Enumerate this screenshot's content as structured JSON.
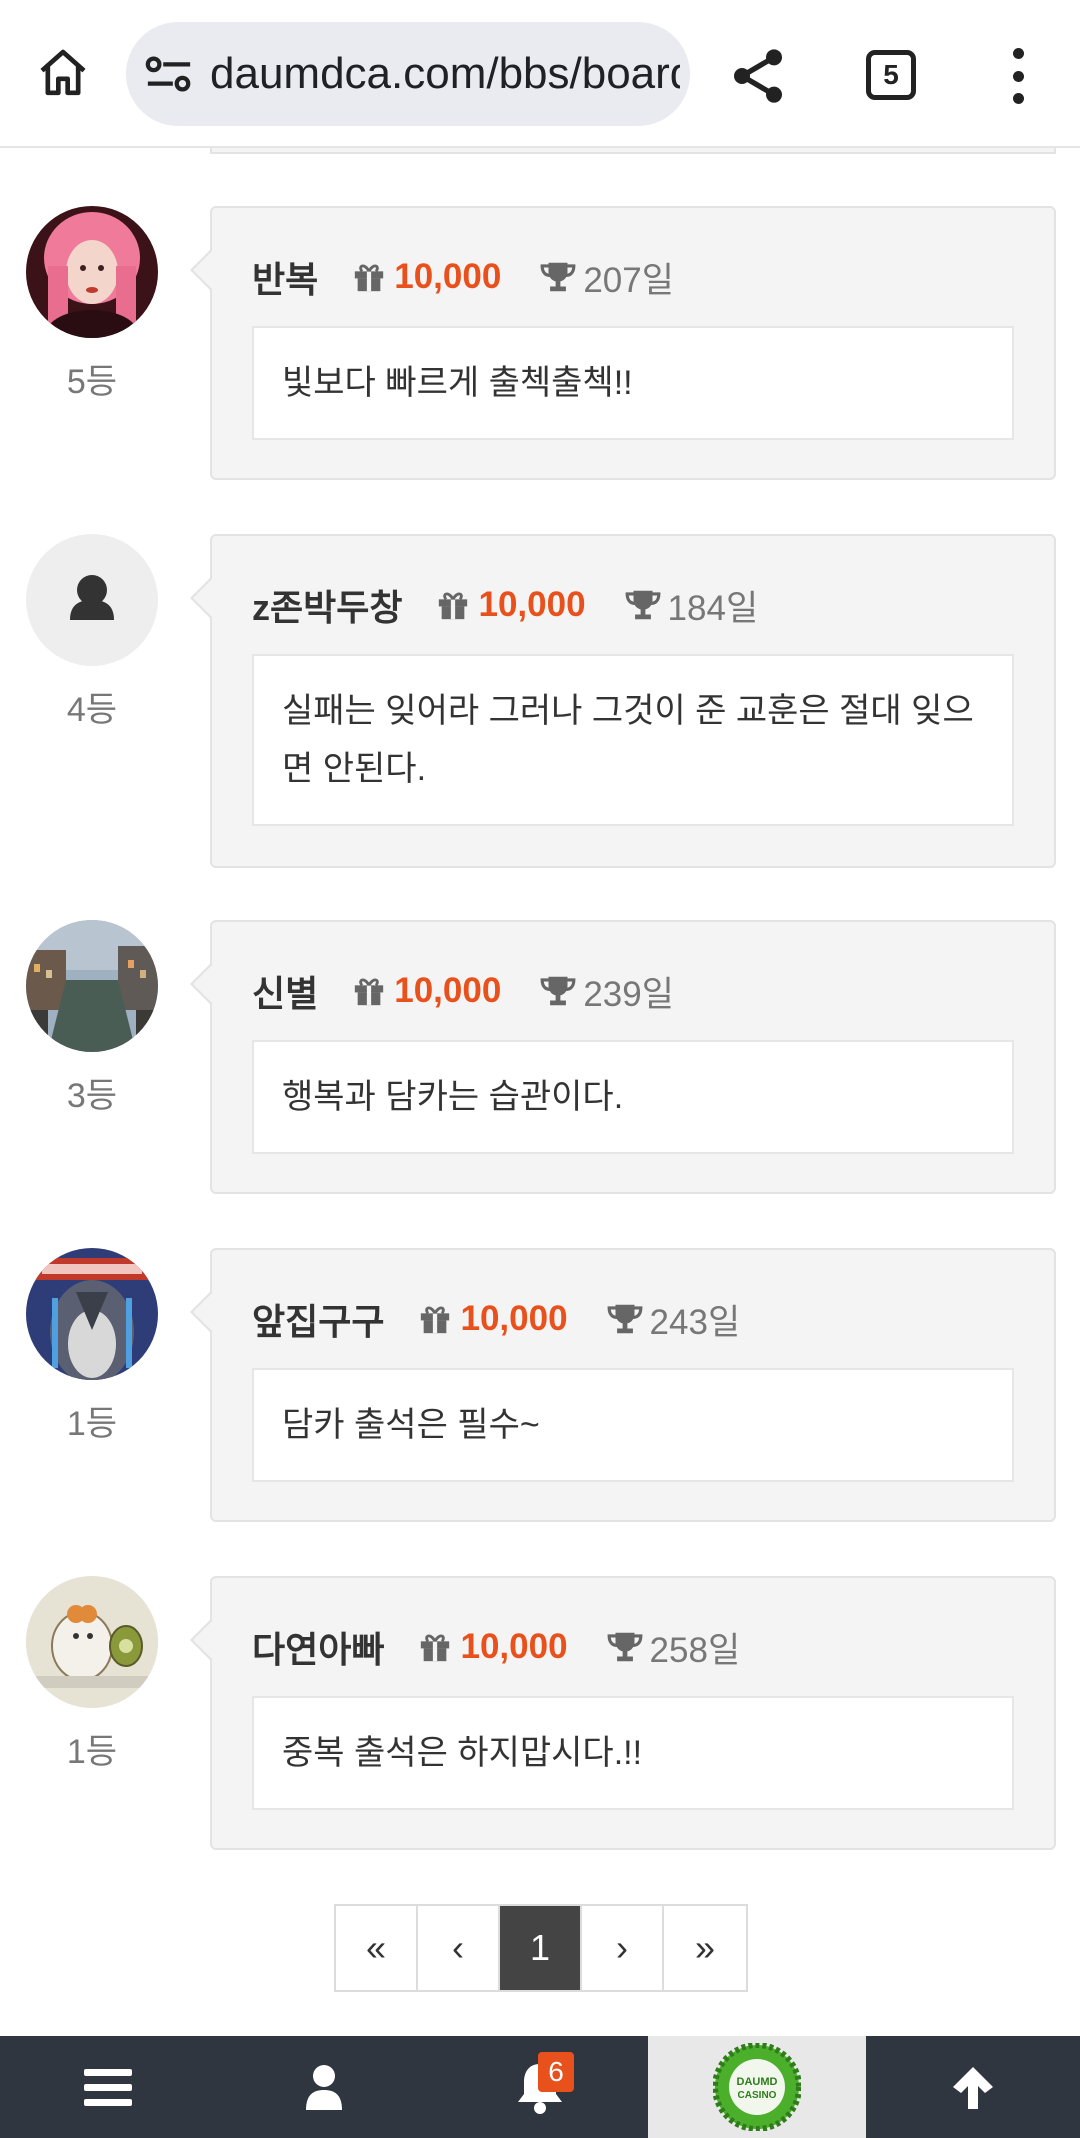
{
  "browser": {
    "url": "daumdca.com/bbs/board",
    "tab_count": "5"
  },
  "comments": [
    {
      "name": "반복",
      "points": "10,000",
      "days": "207일",
      "rank": "5등",
      "message": "빛보다 빠르게 출첵출첵!!",
      "avatar": "pink-hair-portrait"
    },
    {
      "name": "z존박두창",
      "points": "10,000",
      "days": "184일",
      "rank": "4등",
      "message": "실패는 잊어라 그러나 그것이 준 교훈은 절대 잊으면 안된다.",
      "avatar": "default-user"
    },
    {
      "name": "신별",
      "points": "10,000",
      "days": "239일",
      "rank": "3등",
      "message": "행복과 담카는 습관이다.",
      "avatar": "canal-city-photo"
    },
    {
      "name": "앞집구구",
      "points": "10,000",
      "days": "243일",
      "rank": "1등",
      "message": "담카 출석은 필수~",
      "avatar": "penguin-cartoon"
    },
    {
      "name": "다연아빠",
      "points": "10,000",
      "days": "258일",
      "rank": "1등",
      "message": "중복 출석은 하지맙시다.!!",
      "avatar": "hamster-cartoon"
    }
  ],
  "pagination": {
    "first": "«",
    "prev": "‹",
    "current": "1",
    "next": "›",
    "last": "»"
  },
  "bottom_nav": {
    "notification_count": "6",
    "logo_text_line1": "DAUMD",
    "logo_text_line2": "CASINO"
  },
  "colors": {
    "accent": "#e8501c",
    "card_bg": "#f4f4f4",
    "bottom_bar": "#2f3640"
  }
}
